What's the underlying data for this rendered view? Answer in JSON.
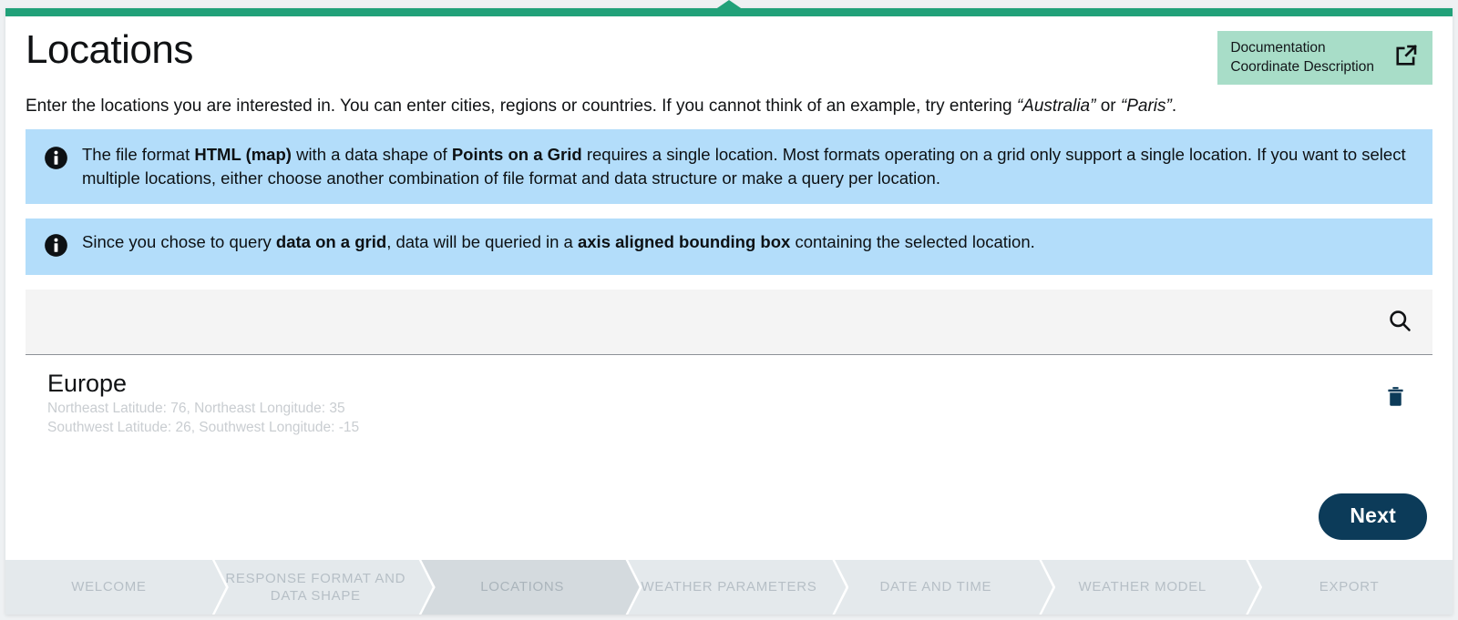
{
  "theme": {
    "accent_green": "#21a179",
    "badge_green": "#a8ddc8",
    "info_blue": "#b3ddfa",
    "button_navy": "#0c3b59",
    "stepper_bg": "#e4e9ec",
    "stepper_active": "#d4dade"
  },
  "header": {
    "title": "Locations",
    "doc_badge": {
      "label": "Documentation\nCoordinate Description",
      "icon": "external-link-icon"
    }
  },
  "intro": {
    "part1": "Enter the locations you are interested in. You can enter cities, regions or countries. If you cannot think of an example, try entering ",
    "example1": "“Australia”",
    "conjunction": " or ",
    "example2": "“Paris”",
    "end": "."
  },
  "info_boxes": [
    {
      "icon": "info-icon",
      "segments": [
        {
          "text": "The file format ",
          "bold": false
        },
        {
          "text": "HTML (map)",
          "bold": true
        },
        {
          "text": " with a data shape of ",
          "bold": false
        },
        {
          "text": "Points on a Grid",
          "bold": true
        },
        {
          "text": " requires a single location. Most formats operating on a grid only support a single location. If you want to select multiple locations, either choose another combination of file format and data structure or make a query per location.",
          "bold": false
        }
      ]
    },
    {
      "icon": "info-icon",
      "segments": [
        {
          "text": "Since you chose to query ",
          "bold": false
        },
        {
          "text": "data on a grid",
          "bold": true
        },
        {
          "text": ", data will be queried in a ",
          "bold": false
        },
        {
          "text": "axis aligned bounding box",
          "bold": true
        },
        {
          "text": " containing the selected location.",
          "bold": false
        }
      ]
    }
  ],
  "search": {
    "value": "",
    "placeholder": "",
    "icon": "search-icon"
  },
  "locations": [
    {
      "name": "Europe",
      "coord_line1": "Northeast Latitude: 76, Northeast Longitude: 35",
      "coord_line2": "Southwest Latitude: 26, Southwest Longitude: -15",
      "delete_icon": "trash-icon"
    }
  ],
  "actions": {
    "next_label": "Next"
  },
  "stepper": {
    "active_index": 2,
    "steps": [
      {
        "label": "WELCOME"
      },
      {
        "label": "RESPONSE FORMAT AND DATA SHAPE"
      },
      {
        "label": "LOCATIONS"
      },
      {
        "label": "WEATHER PARAMETERS"
      },
      {
        "label": "DATE AND TIME"
      },
      {
        "label": "WEATHER MODEL"
      },
      {
        "label": "EXPORT"
      }
    ]
  }
}
